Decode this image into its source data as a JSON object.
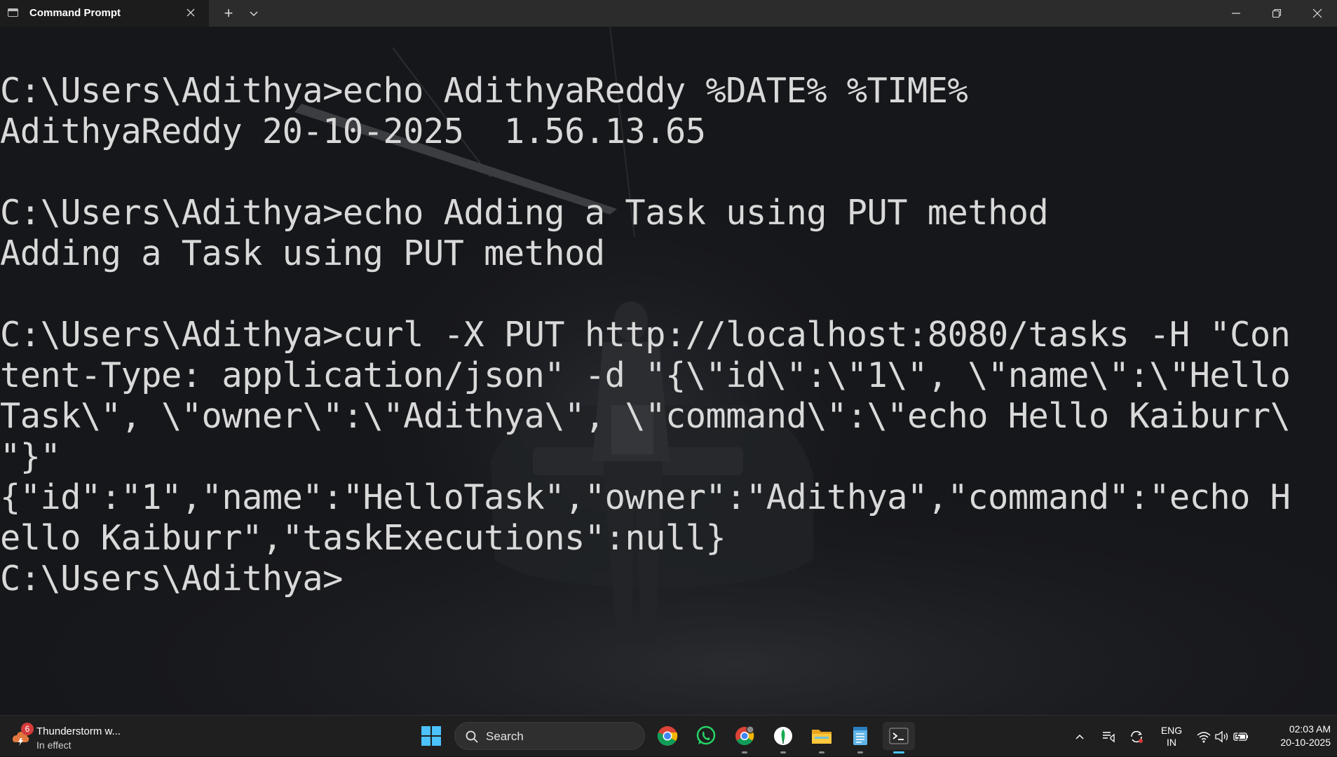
{
  "window": {
    "tab_title": "Command Prompt",
    "new_tab_symbol": "+",
    "icons": {
      "tab": "cmd-icon",
      "close_tab": "close-icon",
      "new_tab": "plus-icon",
      "dropdown": "chevron-down-icon",
      "minimize": "minimize-icon",
      "restore": "restore-icon",
      "close": "close-icon"
    }
  },
  "terminal": {
    "lines": [
      "",
      "C:\\Users\\Adithya>echo AdithyaReddy %DATE% %TIME%",
      "AdithyaReddy 20-10-2025  1.56.13.65",
      "",
      "C:\\Users\\Adithya>echo Adding a Task using PUT method",
      "Adding a Task using PUT method",
      "",
      "C:\\Users\\Adithya>curl -X PUT http://localhost:8080/tasks -H \"Con",
      "tent-Type: application/json\" -d \"{\\\"id\\\":\\\"1\\\", \\\"name\\\":\\\"Hello",
      "Task\\\", \\\"owner\\\":\\\"Adithya\\\", \\\"command\\\":\\\"echo Hello Kaiburr\\",
      "\"}\"",
      "{\"id\":\"1\",\"name\":\"HelloTask\",\"owner\":\"Adithya\",\"command\":\"echo H",
      "ello Kaiburr\",\"taskExecutions\":null}",
      "C:\\Users\\Adithya>"
    ],
    "text_color": "#d9d9d9",
    "background_color": "#15161a"
  },
  "taskbar": {
    "weather": {
      "title": "Thunderstorm w...",
      "subtitle": "In effect",
      "badge": "6",
      "icon": "thunderstorm-icon"
    },
    "start_icon": "windows-start-icon",
    "search": {
      "label": "Search",
      "icon": "search-icon"
    },
    "pinned_apps": [
      "chrome-icon",
      "whatsapp-icon",
      "chrome-profile-icon",
      "mongodb-compass-icon",
      "file-explorer-icon",
      "notepad-icon",
      "terminal-icon"
    ],
    "tray": {
      "icons": [
        "chevron-up-icon",
        "notification-icon",
        "sync-icon",
        "wifi-icon",
        "volume-icon",
        "battery-icon"
      ],
      "language": "ENG",
      "region": "IN",
      "time": "02:03 AM",
      "date": "20-10-2025"
    },
    "accent_color": "#4cc2ff"
  }
}
